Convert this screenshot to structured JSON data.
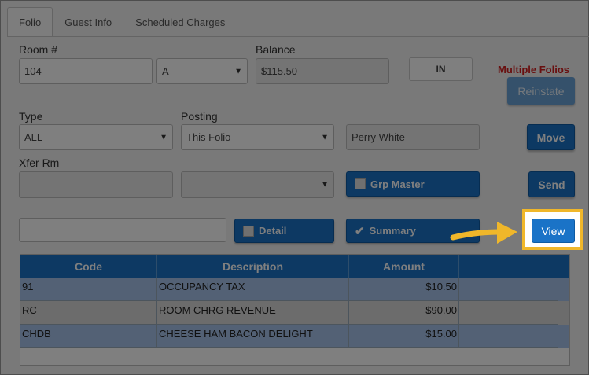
{
  "tabs": [
    "Folio",
    "Guest Info",
    "Scheduled Charges"
  ],
  "room": {
    "label": "Room #",
    "value": "104",
    "suffix": "A"
  },
  "balance": {
    "label": "Balance",
    "value": "$115.50"
  },
  "status_button": "IN",
  "multiple_folios": "Multiple Folios",
  "reinstate_button": "Reinstate",
  "type": {
    "label": "Type",
    "value": "ALL"
  },
  "posting": {
    "label": "Posting",
    "value": "This Folio"
  },
  "guest_name": "Perry White",
  "move_button": "Move",
  "xfer": {
    "label": "Xfer Rm",
    "value": ""
  },
  "grp_master_button": "Grp Master",
  "send_button": "Send",
  "detail_button": "Detail",
  "summary_button": "Summary",
  "view_button": "View",
  "table": {
    "headers": [
      "Code",
      "Description",
      "Amount",
      ""
    ],
    "rows": [
      {
        "code": "91",
        "description": "OCCUPANCY TAX",
        "amount": "$10.50"
      },
      {
        "code": "RC",
        "description": "ROOM CHRG REVENUE",
        "amount": "$90.00"
      },
      {
        "code": "CHDB",
        "description": "CHEESE HAM BACON DELIGHT",
        "amount": "$15.00"
      }
    ]
  },
  "colors": {
    "accent": "#1a73c7",
    "highlight": "#f0b72a",
    "alert": "#d21f1f"
  }
}
